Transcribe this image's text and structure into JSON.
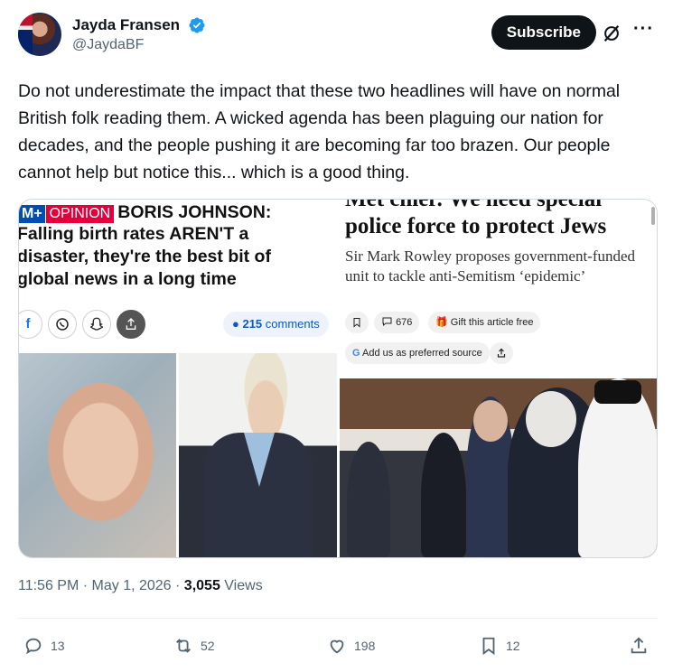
{
  "author": {
    "display_name": "Jayda Fransen",
    "handle": "@JaydaBF",
    "verified_icon": "verified-badge-icon"
  },
  "header": {
    "subscribe_label": "Subscribe",
    "grok_icon": "grok-icon",
    "more_label": "···"
  },
  "tweet": {
    "text": "Do not underestimate the impact that these two headlines will have on normal British folk reading them. A wicked agenda has been plaguing our nation for decades, and the people pushing it are becoming far too brazen. Our people cannot help but notice this... which is a good thing."
  },
  "media": {
    "left": {
      "logo": "M+",
      "section": "OPINION",
      "headline_lines": [
        "BORIS JOHNSON:",
        "Falling birth rates AREN'T a",
        "disaster, they're the best bit of",
        "global news in a long time"
      ],
      "social_icons": [
        "facebook-icon",
        "whatsapp-icon",
        "snapchat-icon",
        "share-icon"
      ],
      "comments_count": "215",
      "comments_label": "comments"
    },
    "right": {
      "cut_title": "Met chief: We need special",
      "title": "police force to protect Jews",
      "subtitle": "Sir Mark Rowley proposes government-funded unit to tackle anti-Semitism ‘epidemic’",
      "bookmark_icon": "bookmark-icon",
      "comment_count": "676",
      "gift_label": "Gift this article free",
      "google_label": "Add us as preferred source",
      "google_letter": "G"
    }
  },
  "meta": {
    "time": "11:56 PM",
    "separator": " · ",
    "date": "May 1, 2026",
    "views_count": "3,055",
    "views_label": "Views"
  },
  "actions": {
    "replies": "13",
    "reposts": "52",
    "likes": "198",
    "bookmarks": "12"
  },
  "colors": {
    "text": "#0f1419",
    "secondary": "#536471",
    "verified": "#1d9bf0",
    "dm_blue": "#004db3",
    "dm_red": "#e4003b"
  }
}
